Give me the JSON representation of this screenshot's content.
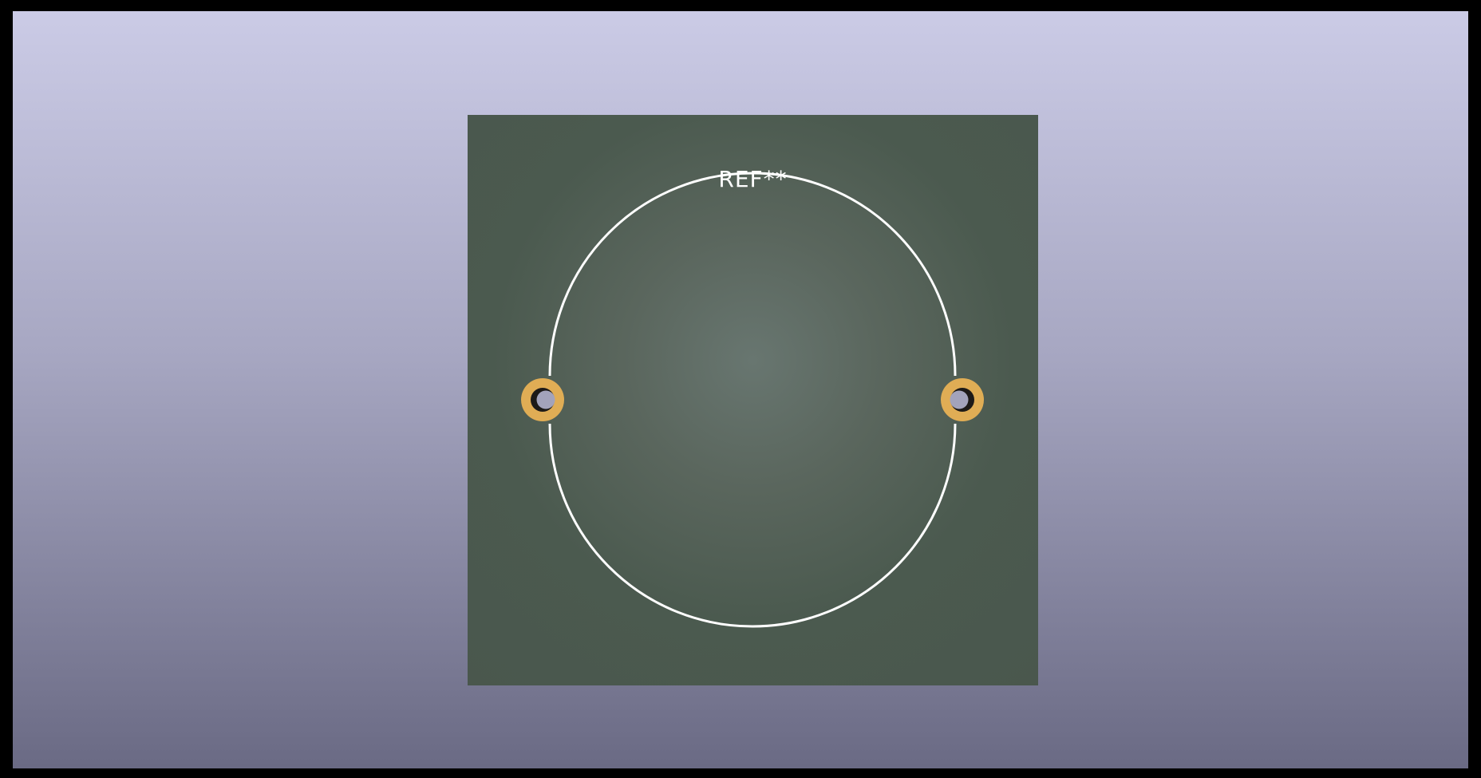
{
  "viewer": {
    "background_top_color": "#cbcbe6",
    "background_bottom_color": "#6a6a84"
  },
  "board": {
    "color": "#4b5a4f",
    "center_color": "#687670"
  },
  "footprint": {
    "reference": "REF**",
    "silkscreen_color": "#ffffff",
    "pad_color": "#e0ad55",
    "pad_count": 2
  }
}
